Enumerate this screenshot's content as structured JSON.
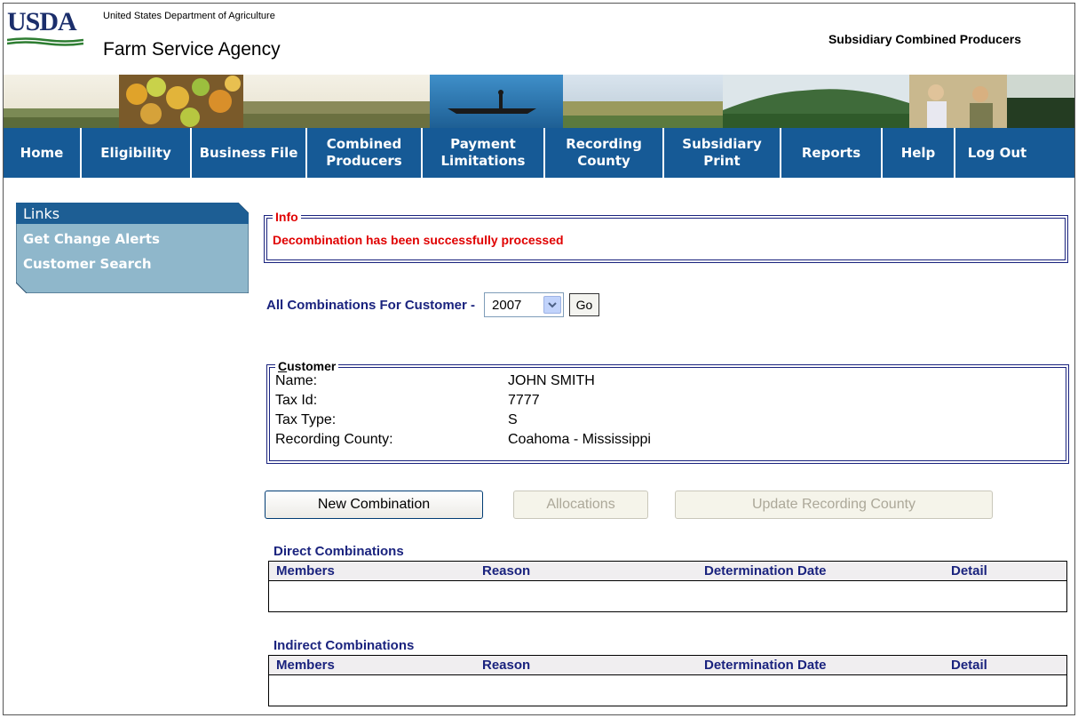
{
  "header": {
    "logo_text": "USDA",
    "department": "United States Department of Agriculture",
    "agency": "Farm Service Agency",
    "app_title": "Subsidiary Combined Producers"
  },
  "nav": [
    {
      "label": "Home"
    },
    {
      "label": "Eligibility"
    },
    {
      "label": "Business File"
    },
    {
      "label": "Combined Producers"
    },
    {
      "label": "Payment Limitations"
    },
    {
      "label": "Recording County"
    },
    {
      "label": "Subsidiary Print"
    },
    {
      "label": "Reports"
    },
    {
      "label": "Help"
    },
    {
      "label": "Log Out"
    }
  ],
  "sidebar": {
    "title": "Links",
    "items": [
      {
        "label": "Get Change Alerts"
      },
      {
        "label": "Customer Search"
      }
    ]
  },
  "info": {
    "legend": "Info",
    "message": "Decombination has been successfully processed"
  },
  "combinations": {
    "label": "All Combinations For Customer -",
    "year": "2007",
    "go_label": "Go"
  },
  "customer": {
    "legend_first": "C",
    "legend_rest": "ustomer",
    "fields": [
      {
        "label": "Name:",
        "value": "JOHN SMITH"
      },
      {
        "label": "Tax Id:",
        "value": "7777"
      },
      {
        "label": "Tax Type:",
        "value": "S"
      },
      {
        "label": "Recording County:",
        "value": "Coahoma - Mississippi"
      }
    ]
  },
  "actions": {
    "new_combination": "New Combination",
    "allocations": "Allocations",
    "update_recording_county": "Update Recording County"
  },
  "direct": {
    "title": "Direct Combinations",
    "columns": [
      "Members",
      "Reason",
      "Determination Date",
      "Detail"
    ]
  },
  "indirect": {
    "title": "Indirect Combinations",
    "columns": [
      "Members",
      "Reason",
      "Determination Date",
      "Detail"
    ]
  },
  "colors": {
    "nav_bg": "#165a96",
    "sidebar_bg": "#8fb7cb",
    "sidebar_title_bg": "#1d5e94",
    "info_text": "#e00000",
    "heading_text": "#1a237e"
  }
}
